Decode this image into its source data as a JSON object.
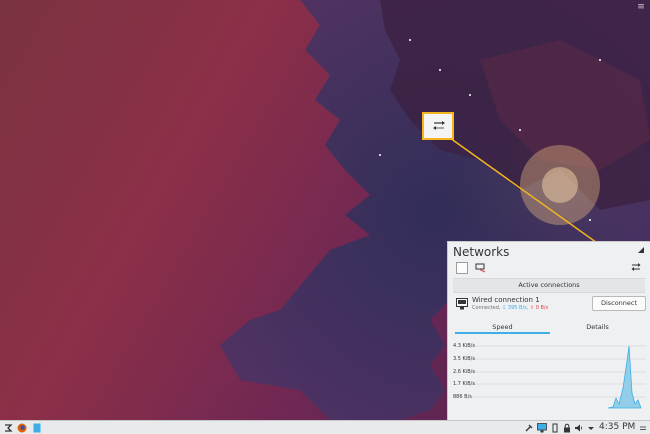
{
  "desktop": {
    "corner_icon": "menu-icon"
  },
  "callout": {
    "icon": "network-connect-icon",
    "color": "#f3b61f"
  },
  "networks": {
    "title": "Networks",
    "section_title": "Active connections",
    "connection": {
      "name": "Wired connection 1",
      "status": "Connected,",
      "down": "⇩ 395 B/s,",
      "up": "⇧ 0 B/s",
      "button": "Disconnect"
    },
    "tabs": {
      "speed": "Speed",
      "details": "Details"
    },
    "graph": {
      "labels": [
        "4.3 KiB/s",
        "3.5 KiB/s",
        "2.6 KiB/s",
        "1.7 KiB/s",
        "886 B/s"
      ]
    }
  },
  "taskbar": {
    "clock": "4:35 PM",
    "items": [
      "application-launcher-icon",
      "firefox-icon",
      "file-manager-icon"
    ],
    "tray": [
      "tools-icon",
      "display-icon",
      "usb-icon",
      "lock-icon",
      "volume-icon",
      "expand-tray-icon"
    ]
  }
}
